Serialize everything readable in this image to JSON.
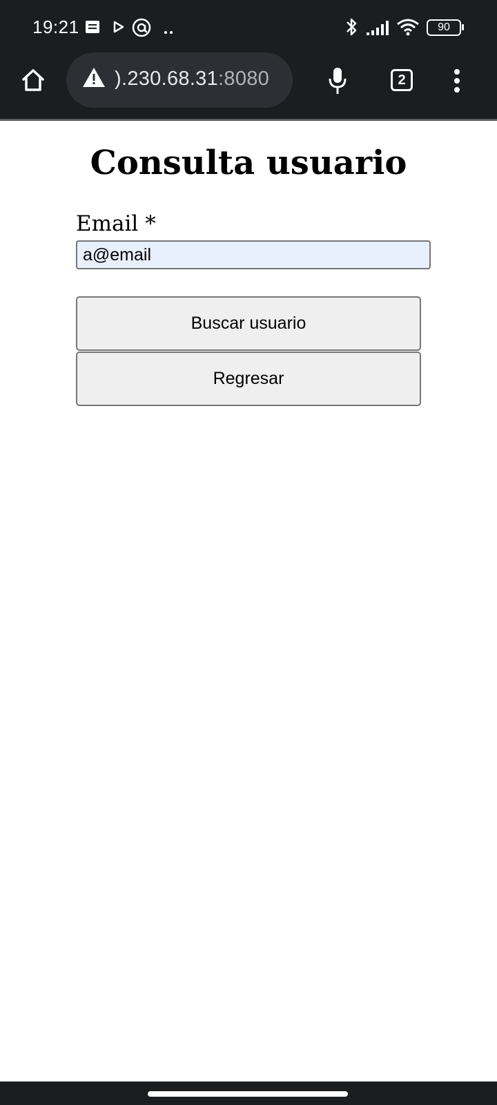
{
  "status_bar": {
    "time": "19:21",
    "battery_level": "90",
    "icons": [
      "notes-icon",
      "play-icon",
      "at-sign-icon",
      "more-notifications-icon",
      "bluetooth-icon",
      "signal-icon",
      "wifi-icon",
      "battery-icon"
    ]
  },
  "browser": {
    "url_host": ").230.68.31",
    "url_port": ":8080",
    "tab_count": "2",
    "icons": [
      "home-icon",
      "warning-icon",
      "mic-icon",
      "tabs-icon",
      "more-vert-icon"
    ]
  },
  "page": {
    "title": "Consulta usuario",
    "email_label": "Email *",
    "email_value": "a@email",
    "search_button": "Buscar usuario",
    "back_button": "Regresar"
  },
  "colors": {
    "chrome_bg": "#1c1d1f",
    "url_pill_bg": "#2c2f34",
    "autofill_bg": "#e8f0fe",
    "button_bg": "#efefef"
  }
}
